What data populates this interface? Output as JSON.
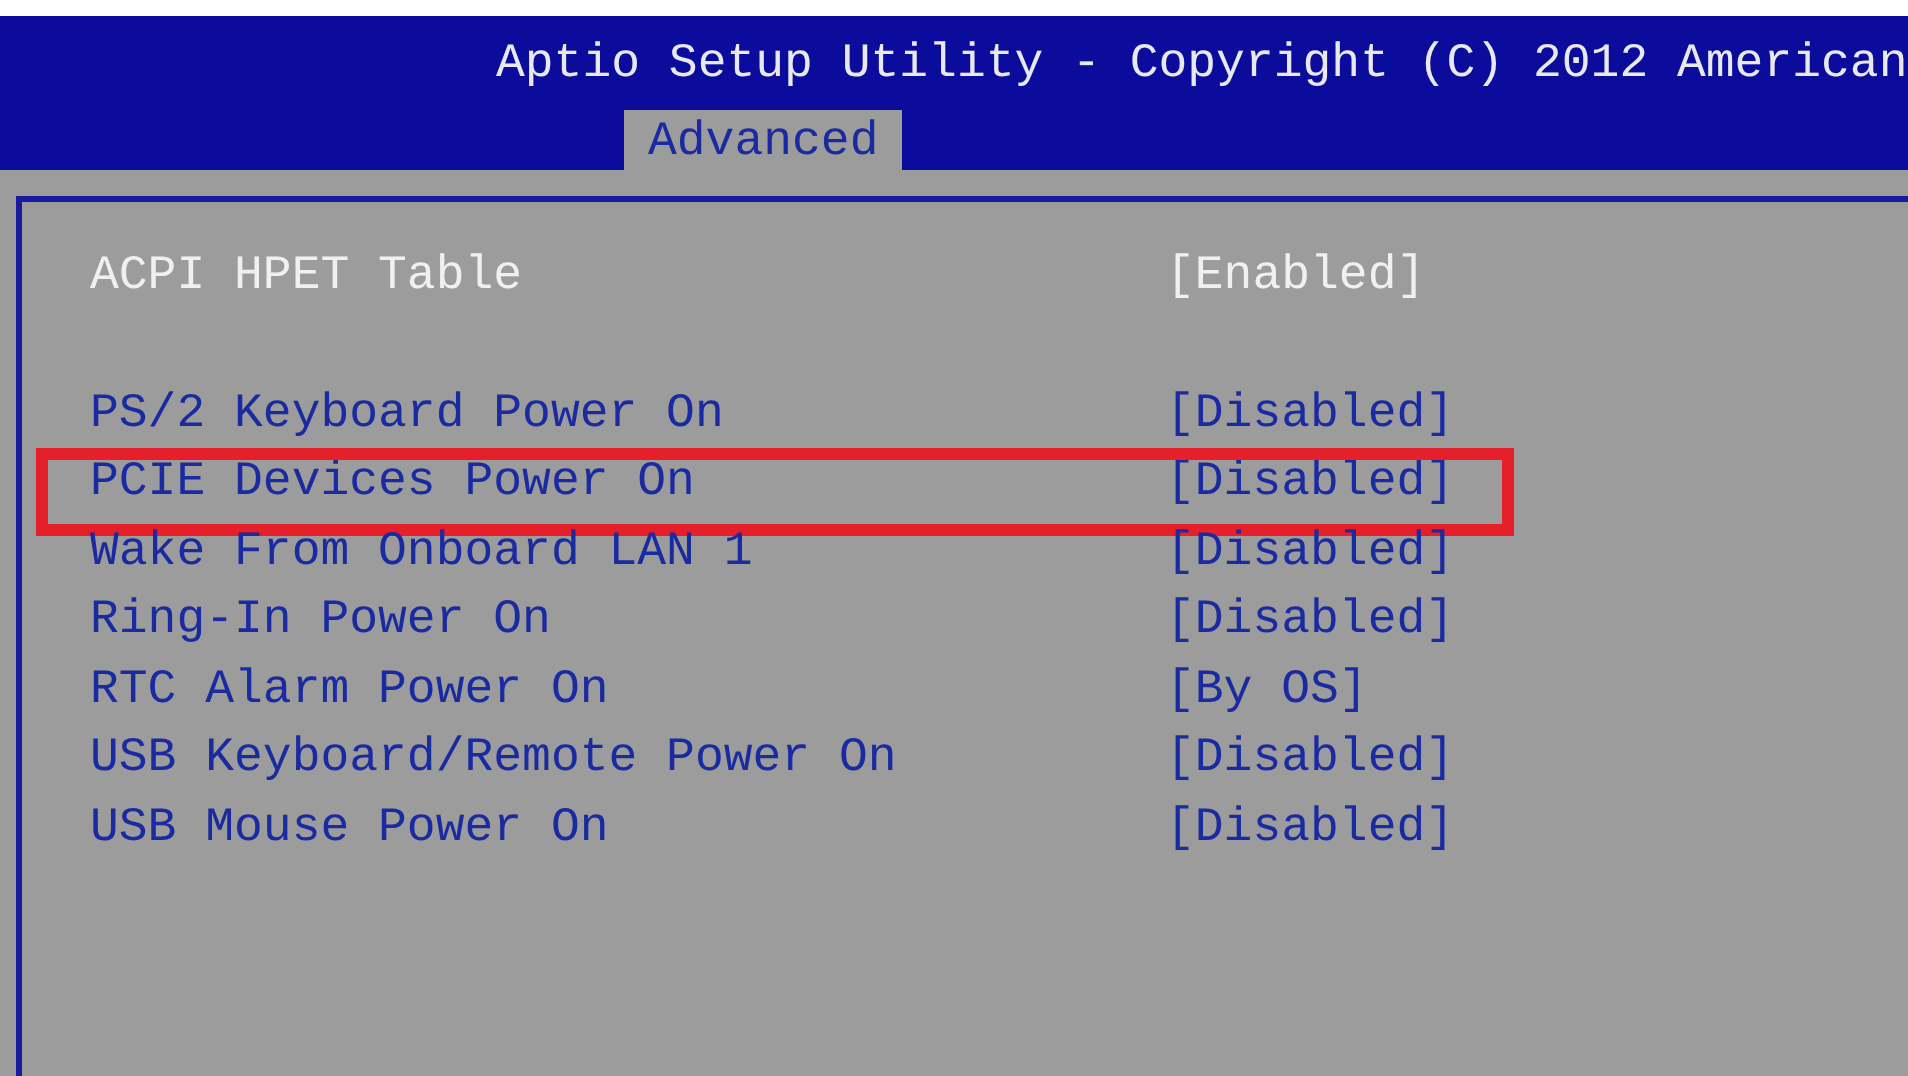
{
  "window": {
    "title": "Aptio Setup Utility - Copyright (C) 2012 American"
  },
  "tabs": [
    {
      "label": "Advanced",
      "selected": true
    }
  ],
  "setting_groups": [
    [
      {
        "label": "ACPI HPET Table",
        "value": "[Enabled]",
        "selected": true,
        "highlighted": false
      }
    ],
    [
      {
        "label": "PS/2 Keyboard Power On",
        "value": "[Disabled]",
        "selected": false,
        "highlighted": false
      },
      {
        "label": "PCIE Devices Power On",
        "value": "[Disabled]",
        "selected": false,
        "highlighted": true
      },
      {
        "label": "Wake From Onboard LAN 1",
        "value": "[Disabled]",
        "selected": false,
        "highlighted": false
      },
      {
        "label": "Ring-In Power On",
        "value": "[Disabled]",
        "selected": false,
        "highlighted": false
      },
      {
        "label": "RTC Alarm Power On",
        "value": "[By OS]",
        "selected": false,
        "highlighted": false
      },
      {
        "label": "USB Keyboard/Remote Power On",
        "value": "[Disabled]",
        "selected": false,
        "highlighted": false
      },
      {
        "label": "USB Mouse Power On",
        "value": "[Disabled]",
        "selected": false,
        "highlighted": false
      }
    ]
  ]
}
